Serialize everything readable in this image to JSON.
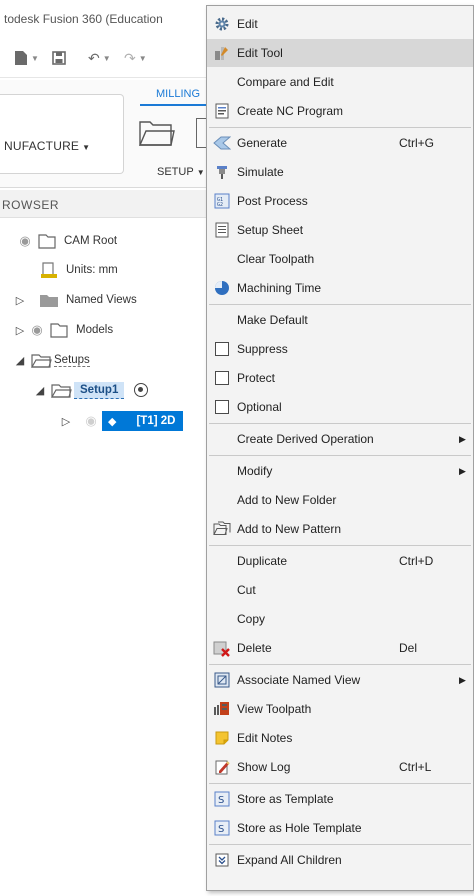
{
  "app": {
    "title": "todesk Fusion 360 (Education",
    "workspace": "NUFACTURE",
    "tab": "MILLING",
    "setup_label": "SETUP",
    "browser_title": "ROWSER"
  },
  "tree": {
    "cam_root": "CAM Root",
    "units": "Units: mm",
    "named_views": "Named Views",
    "models": "Models",
    "setups": "Setups",
    "setup1": "Setup1",
    "operation": "[T1] 2D"
  },
  "menu": {
    "items": [
      {
        "label": "Edit",
        "icon": "gear-icon",
        "shortcut": ""
      },
      {
        "label": "Edit Tool",
        "icon": "edit-tool-icon",
        "shortcut": ""
      },
      {
        "label": "Compare and Edit",
        "icon": "",
        "shortcut": ""
      },
      {
        "label": "Create NC Program",
        "icon": "nc-program-icon",
        "shortcut": ""
      },
      {
        "label": "Generate",
        "icon": "generate-icon",
        "shortcut": "Ctrl+G"
      },
      {
        "label": "Simulate",
        "icon": "simulate-icon",
        "shortcut": ""
      },
      {
        "label": "Post Process",
        "icon": "post-process-icon",
        "shortcut": ""
      },
      {
        "label": "Setup Sheet",
        "icon": "setup-sheet-icon",
        "shortcut": ""
      },
      {
        "label": "Clear Toolpath",
        "icon": "",
        "shortcut": ""
      },
      {
        "label": "Machining Time",
        "icon": "machining-time-icon",
        "shortcut": ""
      },
      {
        "label": "Make Default",
        "icon": "",
        "shortcut": ""
      },
      {
        "label": "Suppress",
        "icon": "checkbox",
        "shortcut": ""
      },
      {
        "label": "Protect",
        "icon": "checkbox",
        "shortcut": ""
      },
      {
        "label": "Optional",
        "icon": "checkbox",
        "shortcut": ""
      },
      {
        "label": "Create Derived Operation",
        "icon": "",
        "shortcut": ""
      },
      {
        "label": "Modify",
        "icon": "",
        "shortcut": ""
      },
      {
        "label": "Add to New Folder",
        "icon": "",
        "shortcut": ""
      },
      {
        "label": "Add to New Pattern",
        "icon": "pattern-icon",
        "shortcut": ""
      },
      {
        "label": "Duplicate",
        "icon": "",
        "shortcut": "Ctrl+D"
      },
      {
        "label": "Cut",
        "icon": "",
        "shortcut": ""
      },
      {
        "label": "Copy",
        "icon": "",
        "shortcut": ""
      },
      {
        "label": "Delete",
        "icon": "delete-icon",
        "shortcut": "Del"
      },
      {
        "label": "Associate Named View",
        "icon": "named-view-icon",
        "shortcut": ""
      },
      {
        "label": "View Toolpath",
        "icon": "view-toolpath-icon",
        "shortcut": ""
      },
      {
        "label": "Edit Notes",
        "icon": "notes-icon",
        "shortcut": ""
      },
      {
        "label": "Show Log",
        "icon": "log-icon",
        "shortcut": "Ctrl+L"
      },
      {
        "label": "Store as Template",
        "icon": "template-icon",
        "shortcut": ""
      },
      {
        "label": "Store as Hole Template",
        "icon": "hole-template-icon",
        "shortcut": ""
      },
      {
        "label": "Expand All Children",
        "icon": "expand-icon",
        "shortcut": ""
      }
    ]
  },
  "colors": {
    "highlight": "#d7d7d7",
    "selection": "#0078d7",
    "menu_bg": "#f3f3f3"
  }
}
